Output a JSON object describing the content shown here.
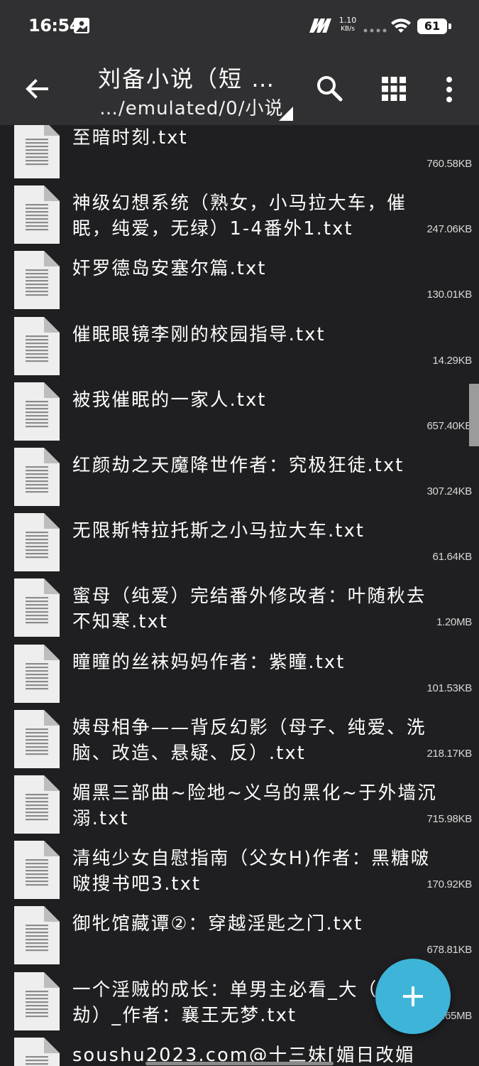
{
  "status_bar": {
    "time": "16:54",
    "net_speed_value": "1.10",
    "net_speed_unit": "KB/s",
    "battery": "61",
    "icons": [
      "photo-icon",
      "m-brand-icon",
      "signal-dots-icon",
      "wifi-icon",
      "battery-icon"
    ]
  },
  "app_bar": {
    "title": "刘备小说（短 …",
    "path": "…/emulated/0/小说",
    "icons": [
      "back-arrow-icon",
      "search-icon",
      "grid-view-icon",
      "more-vert-icon",
      "dropdown-triangle-icon"
    ]
  },
  "files": [
    {
      "name": "至暗时刻.txt",
      "size": "760.58KB"
    },
    {
      "name": "神级幻想系统（熟女，小马拉大车，催眠，纯爱，无绿）1-4番外1.txt",
      "size": "247.06KB"
    },
    {
      "name": "奸罗德岛安塞尔篇.txt",
      "size": "130.01KB"
    },
    {
      "name": "催眠眼镜李刚的校园指导.txt",
      "size": "14.29KB"
    },
    {
      "name": "被我催眠的一家人.txt",
      "size": "657.40KB"
    },
    {
      "name": "红颜劫之天魔降世作者：究极狂徒.txt",
      "size": "307.24KB"
    },
    {
      "name": "无限斯特拉托斯之小马拉大车.txt",
      "size": "61.64KB"
    },
    {
      "name": "蜜母（纯爱）完结番外修改者：叶随秋去不知寒.txt",
      "size": "1.20MB"
    },
    {
      "name": "瞳瞳的丝袜妈妈作者：紫瞳.txt",
      "size": "101.53KB"
    },
    {
      "name": "姨母相争——背反幻影（母子、纯爱、洗脑、改造、悬疑、反）.txt",
      "size": "218.17KB"
    },
    {
      "name": "媚黑三部曲~险地~义乌的黑化~于外墙沉溺.txt",
      "size": "715.98KB"
    },
    {
      "name": "清纯少女自慰指南（父女H)作者：黑糖啵啵搜书吧3.txt",
      "size": "170.92KB"
    },
    {
      "name": "御牝馆藏谭②：穿越淫匙之门.txt",
      "size": "678.81KB"
    },
    {
      "name": "一个淫贼的成长：单男主必看_大（万花劫）_作者：襄王无梦.txt",
      "size": "3.65MB"
    },
    {
      "name": "soushu2023.com@十三妹[媚日改媚",
      "size": ""
    }
  ],
  "fab": {
    "icon": "plus-icon"
  }
}
